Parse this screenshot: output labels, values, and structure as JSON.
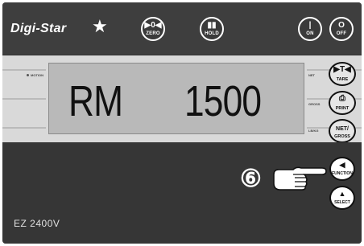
{
  "brand": {
    "logo_text": "Digi-Star",
    "star_glyph": "★"
  },
  "top_buttons": {
    "zero": {
      "symbol": "▶0◀",
      "label": "ZERO"
    },
    "hold": {
      "symbol": "▮▮",
      "label": "HOLD"
    },
    "on": {
      "symbol": "|",
      "label": "ON"
    },
    "off": {
      "symbol": "O",
      "label": "OFF"
    }
  },
  "display": {
    "mode_text": "RM",
    "value_text": "1500",
    "left_indicator": "MOTION",
    "right_indicators": [
      "NET",
      "GROSS",
      "LB/KG"
    ]
  },
  "right_buttons": {
    "tare": {
      "symbol": "▶T◀",
      "label": "TARE"
    },
    "print": {
      "symbol": "⎙",
      "label": "PRINT"
    },
    "net_gross": {
      "symbol": "NET/",
      "label": "GROSS"
    }
  },
  "lower_buttons": {
    "function": {
      "symbol": "◀",
      "label": "FUNCTION"
    },
    "select": {
      "symbol": "▲",
      "label": "SELECT"
    }
  },
  "callout": {
    "step_number": "⑥",
    "pointer_icon": "pointing-hand-icon"
  },
  "model_text": "EZ 2400V",
  "colors": {
    "panel": "#3a3a3a",
    "display_band": "#d9d9d9",
    "lcd": "#b9b9b9"
  }
}
